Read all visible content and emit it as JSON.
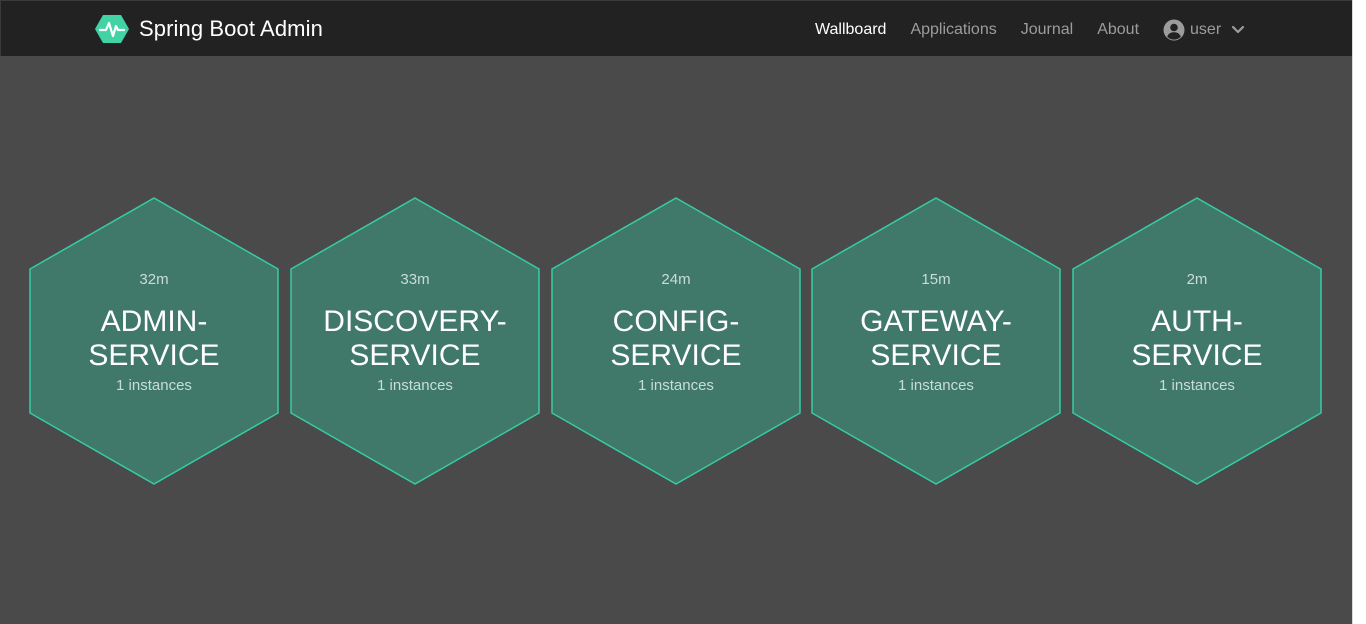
{
  "header": {
    "brand_title": "Spring Boot Admin",
    "nav": [
      {
        "label": "Wallboard",
        "active": true
      },
      {
        "label": "Applications",
        "active": false
      },
      {
        "label": "Journal",
        "active": false
      },
      {
        "label": "About",
        "active": false
      }
    ],
    "user_label": "user"
  },
  "wallboard": {
    "applications": [
      {
        "uptime": "32m",
        "name": "ADMIN-\nSERVICE",
        "instances": "1 instances"
      },
      {
        "uptime": "33m",
        "name": "DISCOVERY-\nSERVICE",
        "instances": "1 instances"
      },
      {
        "uptime": "24m",
        "name": "CONFIG-\nSERVICE",
        "instances": "1 instances"
      },
      {
        "uptime": "15m",
        "name": "GATEWAY-\nSERVICE",
        "instances": "1 instances"
      },
      {
        "uptime": "2m",
        "name": "AUTH-\nSERVICE",
        "instances": "1 instances"
      }
    ]
  },
  "colors": {
    "background": "#4a4a4a",
    "navbar": "#222222",
    "hex_fill": "#40786a",
    "hex_stroke": "#35cda3",
    "brand_accent": "#42d3a5"
  },
  "icons": {
    "brand": "heartbeat-hexagon-icon",
    "user": "user-circle-icon",
    "dropdown": "chevron-down-icon"
  }
}
